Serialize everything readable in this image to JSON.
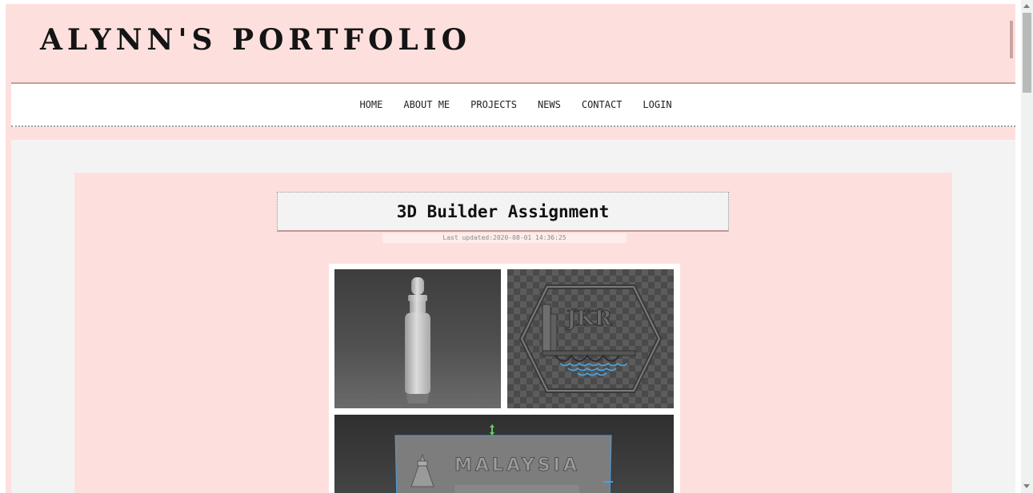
{
  "header": {
    "site_title": "ALYNN'S PORTFOLIO"
  },
  "nav": {
    "items": [
      "HOME",
      "ABOUT ME",
      "PROJECTS",
      "NEWS",
      "CONTACT",
      "LOGIN"
    ]
  },
  "post": {
    "title": "3D Builder Assignment",
    "updated_label": "Last updated:",
    "updated_value": "2020-08-01 14:36:25"
  },
  "gallery": {
    "images": [
      {
        "name": "dropper-bottle-model"
      },
      {
        "name": "jkr-logo-model",
        "text": "JKR"
      },
      {
        "name": "malaysia-airports-model",
        "text": "MALAYSIA"
      }
    ]
  },
  "colors": {
    "page_bg": "#fde0de",
    "content_bg": "#f4f3f3",
    "nav_bg": "#ffffff",
    "accent_line": "#c29f9a"
  }
}
